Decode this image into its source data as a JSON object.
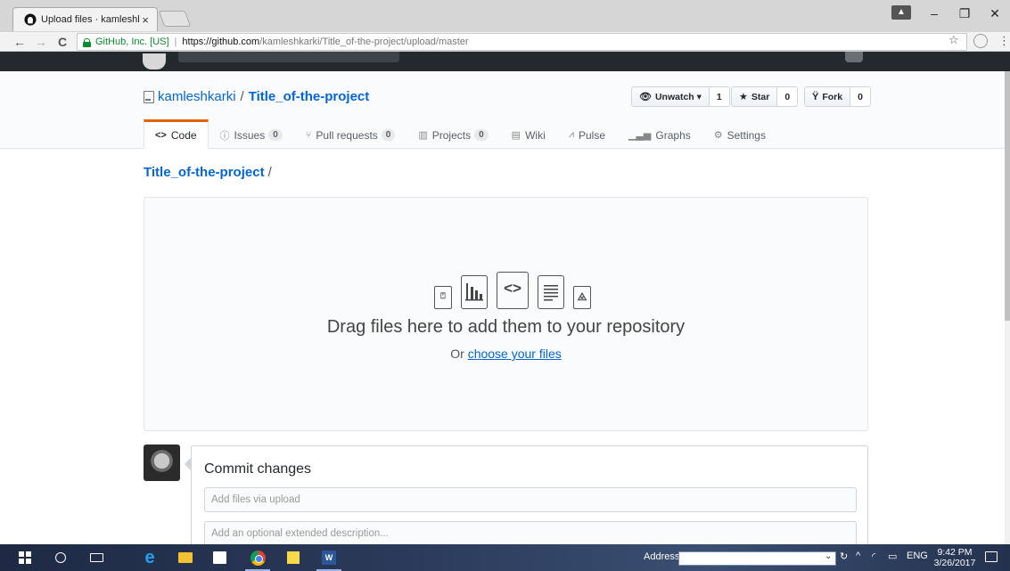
{
  "browser": {
    "tab_title": "Upload files · kamleshka",
    "tab_close": "×",
    "origin_label": "GitHub, Inc. [US]",
    "url_host": "https://github.com",
    "url_path": "/kamleshkarki/Title_of-the-project/upload/master",
    "back": "←",
    "forward": "→",
    "reload": "C",
    "bookmark_star": "☆",
    "menu": "⋮",
    "minimize": "–",
    "restore": "❐",
    "close": "✕"
  },
  "repo": {
    "owner": "kamleshkarki",
    "divider": "/",
    "name": "Title_of-the-project",
    "actions": {
      "watch_label": "Unwatch ▾",
      "watch_count": "1",
      "star_label": "Star",
      "star_count": "0",
      "fork_label": "Fork",
      "fork_count": "0"
    }
  },
  "reponav": {
    "code": "Code",
    "issues": "Issues",
    "issues_count": "0",
    "pulls": "Pull requests",
    "pulls_count": "0",
    "projects": "Projects",
    "projects_count": "0",
    "wiki": "Wiki",
    "pulse": "Pulse",
    "graphs": "Graphs",
    "settings": "Settings"
  },
  "breadcrumb": {
    "repo": "Title_of-the-project",
    "sep": "/"
  },
  "dropzone": {
    "title": "Drag files here to add them to your repository",
    "or": "Or",
    "choose_link": "choose your files"
  },
  "commit": {
    "title": "Commit changes",
    "summary_placeholder": "Add files via upload",
    "description_placeholder": "Add an optional extended description..."
  },
  "taskbar": {
    "address_label": "Address",
    "address_value": "",
    "lang": "ENG",
    "time": "9:42 PM",
    "date": "3/26/2017"
  },
  "colors": {
    "accent": "#0366d6",
    "selected_tab_border": "#e36209",
    "header_bg": "#24292e"
  }
}
